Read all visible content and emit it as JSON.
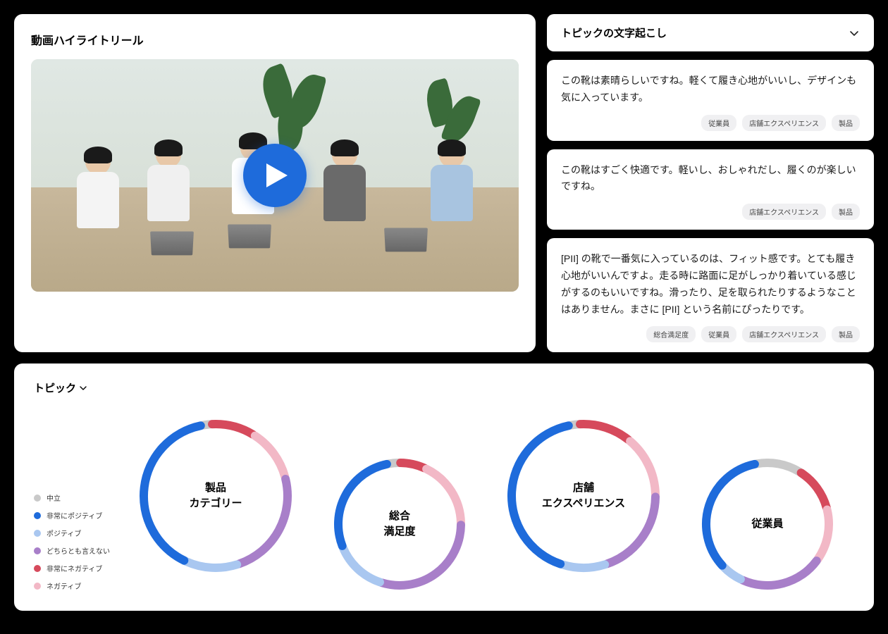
{
  "video": {
    "title": "動画ハイライトリール"
  },
  "transcript": {
    "header": "トピックの文字起こし",
    "items": [
      {
        "text": "この靴は素晴らしいですね。軽くて履き心地がいいし、デザインも気に入っています。",
        "tags": [
          "従業員",
          "店舗エクスペリエンス",
          "製品"
        ]
      },
      {
        "text": "この靴はすごく快適です。軽いし、おしゃれだし、履くのが楽しいですね。",
        "tags": [
          "店舗エクスペリエンス",
          "製品"
        ]
      },
      {
        "text": "[PII] の靴で一番気に入っているのは、フィット感です。とても履き心地がいいんですよ。走る時に路面に足がしっかり着いている感じがするのもいいですね。滑ったり、足を取られたりするようなことはありません。まさに [PII] という名前にぴったりです。",
        "tags": [
          "総合満足度",
          "従業員",
          "店舗エクスペリエンス",
          "製品"
        ]
      }
    ]
  },
  "topics": {
    "title": "トピック",
    "legend": [
      {
        "label": "中立",
        "color": "#c9c9c9"
      },
      {
        "label": "非常にポジティブ",
        "color": "#1e6bdb"
      },
      {
        "label": "ポジティブ",
        "color": "#a9c7f0"
      },
      {
        "label": "どちらとも言えない",
        "color": "#a87fc9"
      },
      {
        "label": "非常にネガティブ",
        "color": "#d64a5c"
      },
      {
        "label": "ネガティブ",
        "color": "#f2b8c6"
      }
    ]
  },
  "chart_data": [
    {
      "type": "pie",
      "title": "製品\nカテゴリー",
      "series": [
        {
          "name": "中立",
          "value": 2
        },
        {
          "name": "非常にポジティブ",
          "value": 40
        },
        {
          "name": "ポジティブ",
          "value": 12
        },
        {
          "name": "どちらとも言えない",
          "value": 24
        },
        {
          "name": "非常にネガティブ",
          "value": 10
        },
        {
          "name": "ネガティブ",
          "value": 12
        }
      ],
      "size": 220,
      "offset": false
    },
    {
      "type": "pie",
      "title": "総合\n満足度",
      "series": [
        {
          "name": "中立",
          "value": 3
        },
        {
          "name": "非常にポジティブ",
          "value": 28
        },
        {
          "name": "ポジティブ",
          "value": 14
        },
        {
          "name": "どちらとも言えない",
          "value": 30
        },
        {
          "name": "非常にネガティブ",
          "value": 7
        },
        {
          "name": "ネガティブ",
          "value": 18
        }
      ],
      "size": 190,
      "offset": true
    },
    {
      "type": "pie",
      "title": "店舗\nエクスペリエンス",
      "series": [
        {
          "name": "中立",
          "value": 2
        },
        {
          "name": "非常にポジティブ",
          "value": 42
        },
        {
          "name": "ポジティブ",
          "value": 10
        },
        {
          "name": "どちらとも言えない",
          "value": 20
        },
        {
          "name": "非常にネガティブ",
          "value": 12
        },
        {
          "name": "ネガティブ",
          "value": 14
        }
      ],
      "size": 220,
      "offset": false
    },
    {
      "type": "pie",
      "title": "従業員",
      "series": [
        {
          "name": "中立",
          "value": 12
        },
        {
          "name": "非常にポジティブ",
          "value": 34
        },
        {
          "name": "ポジティブ",
          "value": 6
        },
        {
          "name": "どちらとも言えない",
          "value": 22
        },
        {
          "name": "非常にネガティブ",
          "value": 12
        },
        {
          "name": "ネガティブ",
          "value": 14
        }
      ],
      "size": 190,
      "offset": true
    }
  ]
}
